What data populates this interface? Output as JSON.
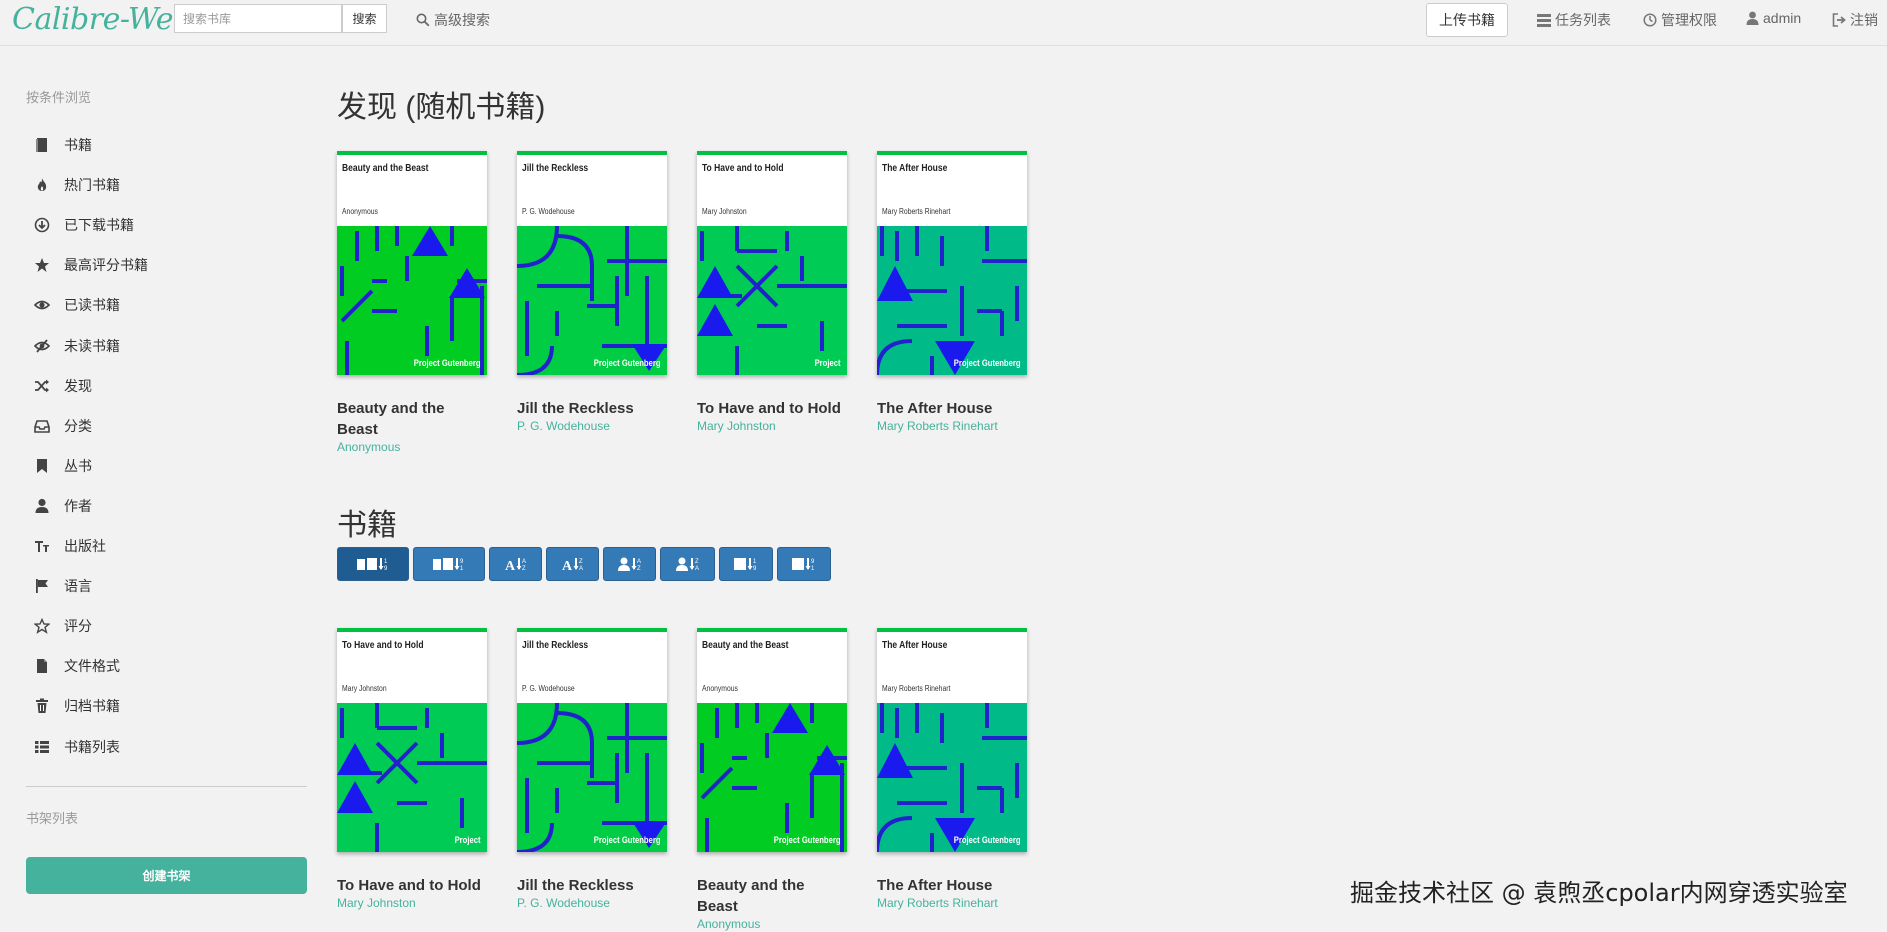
{
  "brand": "Calibre-Web",
  "header": {
    "search_placeholder": "搜索书库",
    "search_button": "搜索",
    "advanced_search": "高级搜索",
    "upload": "上传书籍",
    "tasks": "任务列表",
    "admin_panel": "管理权限",
    "user": "admin",
    "logout": "注销"
  },
  "sidebar": {
    "browse_heading": "按条件浏览",
    "items": [
      {
        "label": "书籍",
        "icon": "book-icon"
      },
      {
        "label": "热门书籍",
        "icon": "fire-icon"
      },
      {
        "label": "已下载书籍",
        "icon": "download-circle-icon"
      },
      {
        "label": "最高评分书籍",
        "icon": "star-icon"
      },
      {
        "label": "已读书籍",
        "icon": "eye-icon"
      },
      {
        "label": "未读书籍",
        "icon": "eye-slash-icon"
      },
      {
        "label": "发现",
        "icon": "random-icon"
      },
      {
        "label": "分类",
        "icon": "inbox-icon"
      },
      {
        "label": "丛书",
        "icon": "bookmark-icon"
      },
      {
        "label": "作者",
        "icon": "user-icon"
      },
      {
        "label": "出版社",
        "icon": "text-size-icon"
      },
      {
        "label": "语言",
        "icon": "flag-icon"
      },
      {
        "label": "评分",
        "icon": "star-empty-icon"
      },
      {
        "label": "文件格式",
        "icon": "file-icon"
      },
      {
        "label": "归档书籍",
        "icon": "trash-icon"
      },
      {
        "label": "书籍列表",
        "icon": "th-list-icon"
      }
    ],
    "shelves_heading": "书架列表",
    "create_shelf": "创建书架"
  },
  "discover": {
    "title": "发现 (随机书籍)",
    "books": [
      {
        "title": "Beauty and the Beast",
        "author": "Anonymous",
        "cover_title": "Beauty and the Beast",
        "cover_author": "Anonymous",
        "publisher": "Project Gutenberg",
        "variant": "b",
        "bg": "#00cc22"
      },
      {
        "title": "Jill the Reckless",
        "author": "P. G. Wodehouse",
        "cover_title": "Jill the Reckless",
        "cover_author": "P. G. Wodehouse",
        "publisher": "Project Gutenberg",
        "variant": "j",
        "bg": "#00cc44"
      },
      {
        "title": "To Have and to Hold",
        "author": "Mary Johnston",
        "cover_title": "To Have and to Hold",
        "cover_author": "Mary Johnston",
        "publisher": "Project",
        "variant": "t",
        "bg": "#00cc55"
      },
      {
        "title": "The After House",
        "author": "Mary Roberts Rinehart",
        "cover_title": "The After House",
        "cover_author": "Mary Roberts Rinehart",
        "publisher": "Project Gutenberg",
        "variant": "a",
        "bg": "#00bb88"
      }
    ]
  },
  "books_section": {
    "title": "书籍",
    "sort_buttons": [
      {
        "name": "sort-newest-button",
        "icon": "book-calendar-desc-icon",
        "active": true
      },
      {
        "name": "sort-oldest-button",
        "icon": "book-calendar-asc-icon",
        "active": false
      },
      {
        "name": "sort-title-az-button",
        "icon": "alpha-asc-icon",
        "active": false
      },
      {
        "name": "sort-title-za-button",
        "icon": "alpha-desc-icon",
        "active": false
      },
      {
        "name": "sort-author-az-button",
        "icon": "user-alpha-asc-icon",
        "active": false
      },
      {
        "name": "sort-author-za-button",
        "icon": "user-alpha-desc-icon",
        "active": false
      },
      {
        "name": "sort-pubdate-newest-button",
        "icon": "calendar-desc-icon",
        "active": false
      },
      {
        "name": "sort-pubdate-oldest-button",
        "icon": "calendar-asc-icon",
        "active": false
      }
    ],
    "books": [
      {
        "title": "To Have and to Hold",
        "author": "Mary Johnston",
        "cover_title": "To Have and to Hold",
        "cover_author": "Mary Johnston",
        "publisher": "Project",
        "variant": "t",
        "bg": "#00cc55"
      },
      {
        "title": "Jill the Reckless",
        "author": "P. G. Wodehouse",
        "cover_title": "Jill the Reckless",
        "cover_author": "P. G. Wodehouse",
        "publisher": "Project Gutenberg",
        "variant": "j",
        "bg": "#00cc44"
      },
      {
        "title": "Beauty and the Beast",
        "author": "Anonymous",
        "cover_title": "Beauty and the Beast",
        "cover_author": "Anonymous",
        "publisher": "Project Gutenberg",
        "variant": "b",
        "bg": "#00cc22"
      },
      {
        "title": "The After House",
        "author": "Mary Roberts Rinehart",
        "cover_title": "The After House",
        "cover_author": "Mary Roberts Rinehart",
        "publisher": "Project Gutenberg",
        "variant": "a",
        "bg": "#00bb88"
      }
    ]
  },
  "watermark": "掘金技术社区 @ 袁煦丞cpolar内网穿透实验室",
  "colors": {
    "accent": "#45b29d",
    "sort_button": "#337ab7",
    "sort_button_active": "#1f5c92",
    "cover_lines": "#2222cc",
    "cover_shapes": "#1a1aee"
  }
}
